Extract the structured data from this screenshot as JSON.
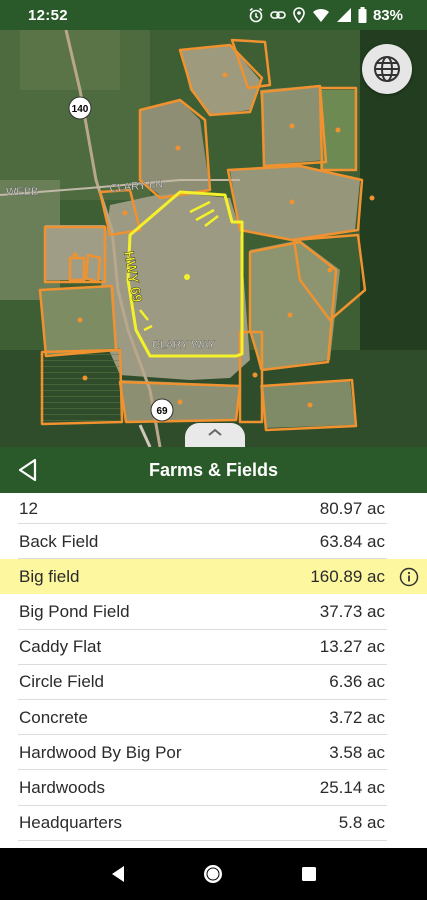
{
  "status_bar": {
    "time": "12:52",
    "battery": "83%",
    "icons": [
      "alarm-icon",
      "link-icon",
      "location-icon",
      "wifi-icon",
      "signal-icon",
      "battery-icon"
    ]
  },
  "map": {
    "road_labels": [
      "CLARY LN",
      "WEBB",
      "CLARY WAY",
      "140",
      "69"
    ],
    "highlight_label": "HWY 69"
  },
  "header": {
    "title": "Farms & Fields"
  },
  "fields": [
    {
      "name": "12",
      "area": "80.97 ac",
      "selected": false
    },
    {
      "name": "Back Field",
      "area": "63.84 ac",
      "selected": false
    },
    {
      "name": "Big field",
      "area": "160.89 ac",
      "selected": true
    },
    {
      "name": "Big Pond Field",
      "area": "37.73 ac",
      "selected": false
    },
    {
      "name": "Caddy Flat",
      "area": "13.27 ac",
      "selected": false
    },
    {
      "name": "Circle Field",
      "area": "6.36 ac",
      "selected": false
    },
    {
      "name": "Concrete",
      "area": "3.72 ac",
      "selected": false
    },
    {
      "name": "Hardwood By Big Por",
      "area": "3.58 ac",
      "selected": false
    },
    {
      "name": "Hardwoods",
      "area": "25.14 ac",
      "selected": false
    },
    {
      "name": "Headquarters",
      "area": "5.8 ac",
      "selected": false
    }
  ],
  "colors": {
    "brand_green": "#2a5a2a",
    "field_outline": "#f0922f",
    "selected_outline": "#f4f02a",
    "selected_row": "#fdf7a0"
  }
}
